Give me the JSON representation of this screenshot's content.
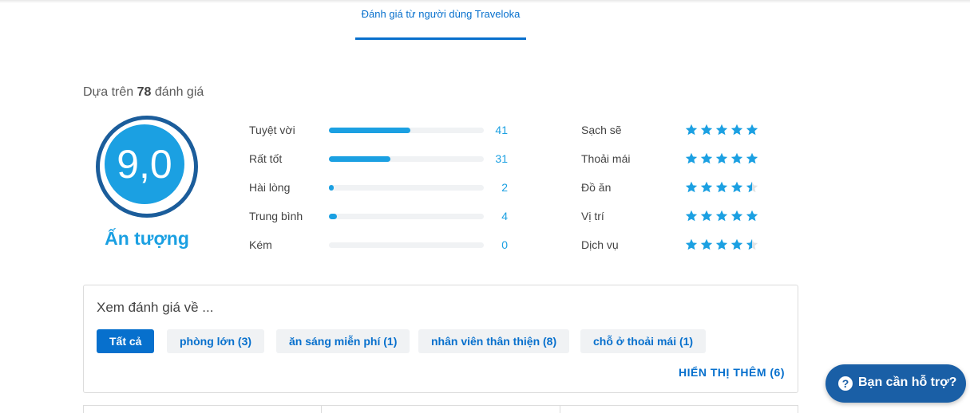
{
  "tabs": {
    "active_label": "Đánh giá từ người dùng Traveloka"
  },
  "summary": {
    "prefix": "Dựa trên",
    "count": "78",
    "suffix": "đánh giá"
  },
  "score": {
    "value": "9,0",
    "label": "Ấn tượng"
  },
  "distribution": [
    {
      "label": "Tuyệt vời",
      "count": "41",
      "fraction": 0.526
    },
    {
      "label": "Rất tốt",
      "count": "31",
      "fraction": 0.397
    },
    {
      "label": "Hài lòng",
      "count": "2",
      "fraction": 0.026
    },
    {
      "label": "Trung bình",
      "count": "4",
      "fraction": 0.051
    },
    {
      "label": "Kém",
      "count": "0",
      "fraction": 0
    }
  ],
  "categories": [
    {
      "label": "Sạch sẽ",
      "stars": 5
    },
    {
      "label": "Thoải mái",
      "stars": 5
    },
    {
      "label": "Đồ ăn",
      "stars": 4.5
    },
    {
      "label": "Vị trí",
      "stars": 5
    },
    {
      "label": "Dịch vụ",
      "stars": 4.5
    }
  ],
  "filter": {
    "title": "Xem đánh giá về ...",
    "chips": [
      {
        "label": "Tất cả",
        "active": true
      },
      {
        "label": "phòng lớn (3)",
        "active": false
      },
      {
        "label": "ăn sáng miễn phí (1)",
        "active": false
      },
      {
        "label": "nhân viên thân thiện (8)",
        "active": false
      },
      {
        "label": "chỗ ở thoải mái (1)",
        "active": false
      }
    ],
    "show_more": "HIỂN THỊ THÊM (6)"
  },
  "help": {
    "label": "Bạn cần hỗ trợ?",
    "icon": "question-circle-icon"
  },
  "colors": {
    "primary": "#0770cd",
    "accent": "#1ba0e2",
    "ring": "#1b5d9b",
    "help_bg": "#1a5fa6"
  }
}
